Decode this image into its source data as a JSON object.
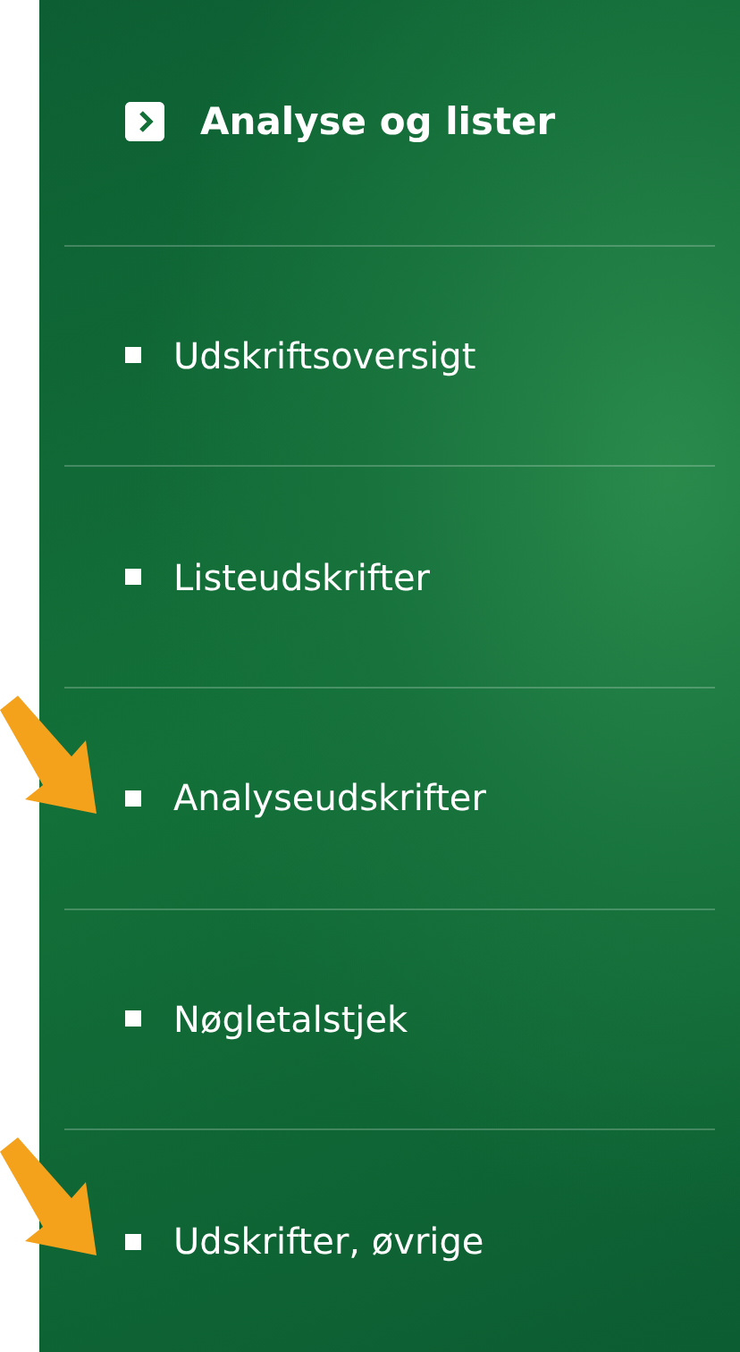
{
  "menu": {
    "title": "Analyse og lister",
    "items": [
      {
        "label": "Udskriftsoversigt",
        "arrow": false
      },
      {
        "label": "Listeudskrifter",
        "arrow": false
      },
      {
        "label": "Analyseudskrifter",
        "arrow": true
      },
      {
        "label": "Nøgletalstjek",
        "arrow": false
      },
      {
        "label": "Udskrifter, øvrige",
        "arrow": true
      }
    ]
  }
}
